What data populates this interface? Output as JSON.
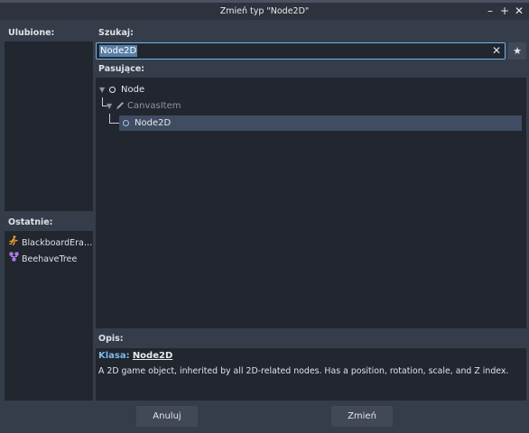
{
  "window": {
    "title": "Zmień typ \"Node2D\""
  },
  "favorites": {
    "label": "Ulubione:"
  },
  "recent": {
    "label": "Ostatnie:",
    "items": [
      {
        "label": "BlackboardEra…",
        "icon": "runner-icon",
        "color": "#f0a030"
      },
      {
        "label": "BeehaveTree",
        "icon": "tree-nodes-icon",
        "color": "#b07ae8"
      }
    ]
  },
  "search": {
    "label": "Szukaj:",
    "value": "Node2D"
  },
  "matches": {
    "label": "Pasujące:",
    "items": [
      {
        "label": "Node",
        "icon": "node-icon"
      },
      {
        "label": "CanvasItem",
        "icon": "pencil-icon"
      },
      {
        "label": "Node2D",
        "icon": "node2d-icon"
      }
    ]
  },
  "description": {
    "label": "Opis:",
    "class_key": "Klasa:",
    "class_value": "Node2D",
    "text": "A 2D game object, inherited by all 2D-related nodes. Has a position, rotation, scale, and Z index."
  },
  "buttons": {
    "cancel": "Anuluj",
    "ok": "Zmień"
  },
  "colors": {
    "accent": "#6fb3e6",
    "selection": "#3f4c61",
    "panel": "#21262f",
    "background": "#363d4a"
  }
}
